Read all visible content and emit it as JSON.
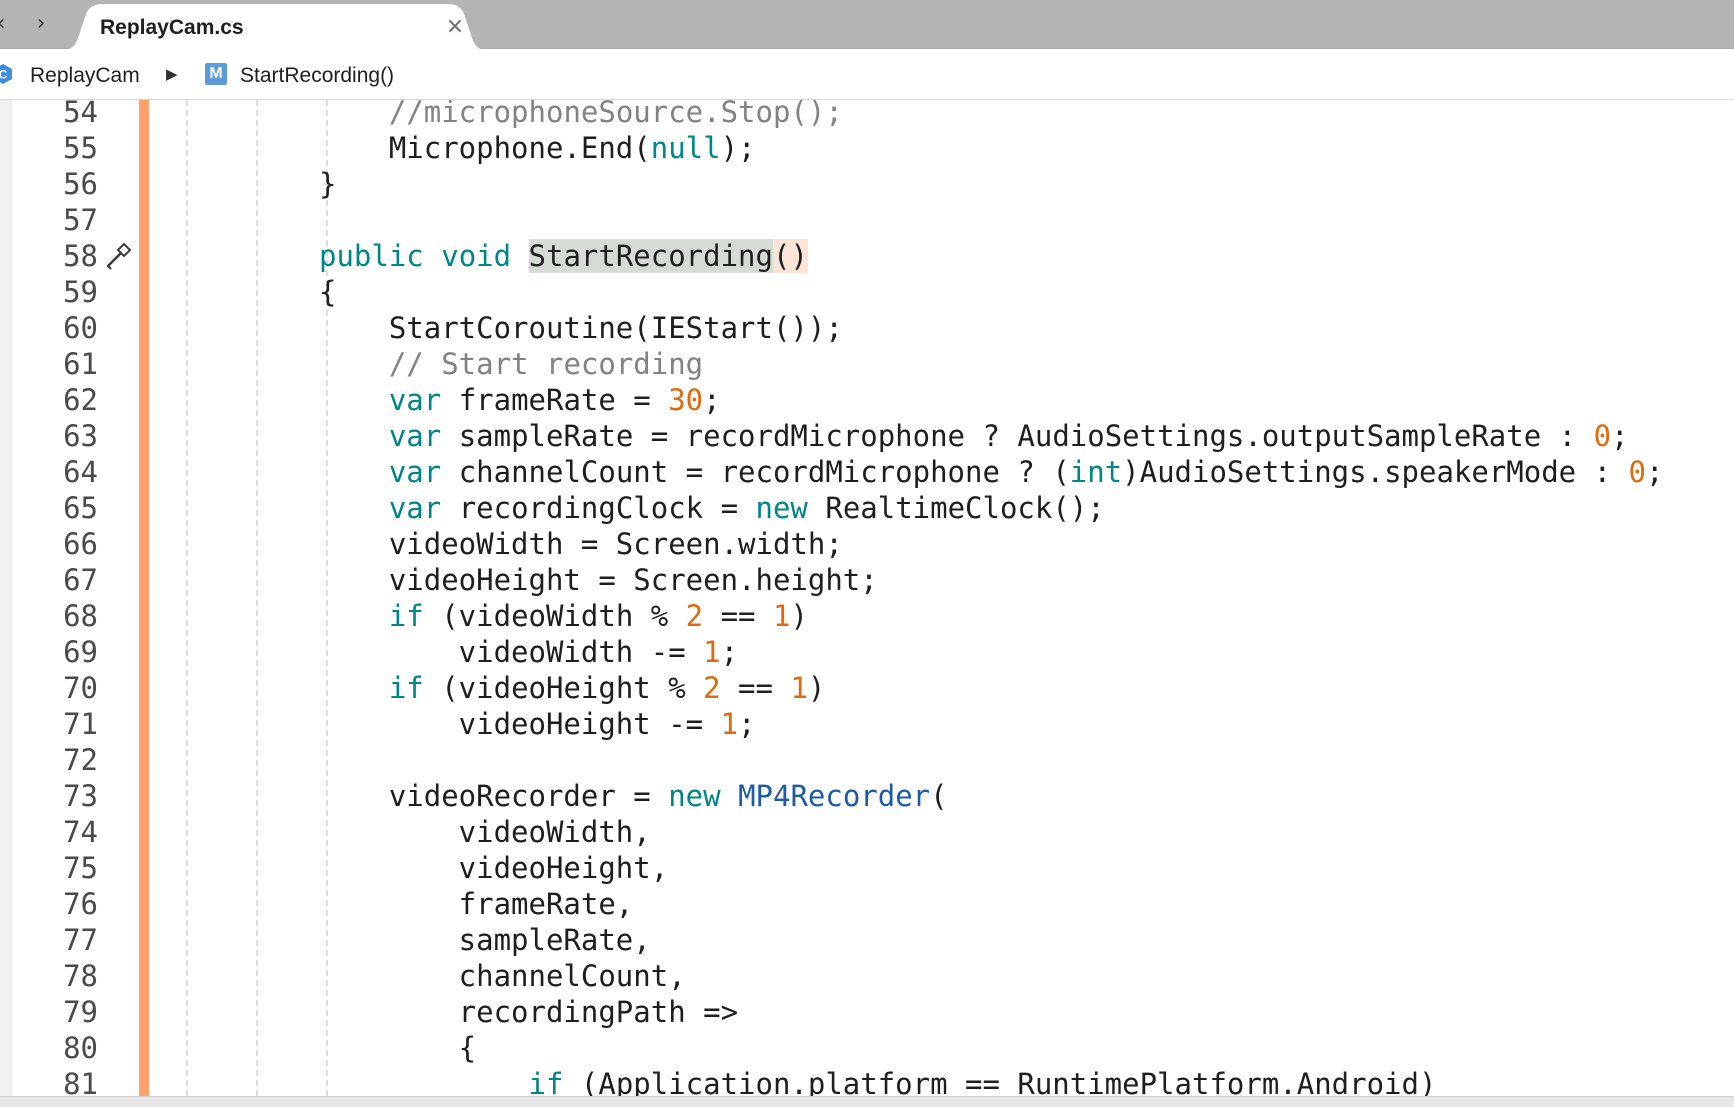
{
  "tabbar": {
    "back_glyph": "‹",
    "forward_glyph": "›",
    "tab_title": "ReplayCam.cs",
    "close_glyph": "×"
  },
  "breadcrumb": {
    "class_name": "ReplayCam",
    "class_icon": "class-icon",
    "separator": "▶",
    "method_icon_letter": "M",
    "method_name": "StartRecording()"
  },
  "colors": {
    "keyword": "#00858a",
    "number": "#de6a0d",
    "comment": "#828282",
    "type": "#1f5aa6",
    "change_bar": "#ff9f6b",
    "method_highlight": "#d4dcd4"
  },
  "editor": {
    "lines": [
      {
        "n": "54",
        "c": "    //microphoneSource.Stop();"
      },
      {
        "n": "55",
        "c": "    Microphone.End(null);"
      },
      {
        "n": "56",
        "c": "}"
      },
      {
        "n": "57",
        "c": ""
      },
      {
        "n": "58",
        "c": "public void StartRecording()",
        "gutter_icon": "hammer-icon"
      },
      {
        "n": "59",
        "c": "{"
      },
      {
        "n": "60",
        "c": "    StartCoroutine(IEStart());"
      },
      {
        "n": "61",
        "c": "    // Start recording"
      },
      {
        "n": "62",
        "c": "    var frameRate = 30;"
      },
      {
        "n": "63",
        "c": "    var sampleRate = recordMicrophone ? AudioSettings.outputSampleRate : 0;"
      },
      {
        "n": "64",
        "c": "    var channelCount = recordMicrophone ? (int)AudioSettings.speakerMode : 0;"
      },
      {
        "n": "65",
        "c": "    var recordingClock = new RealtimeClock();"
      },
      {
        "n": "66",
        "c": "    videoWidth = Screen.width;"
      },
      {
        "n": "67",
        "c": "    videoHeight = Screen.height;"
      },
      {
        "n": "68",
        "c": "    if (videoWidth % 2 == 1)"
      },
      {
        "n": "69",
        "c": "        videoWidth -= 1;"
      },
      {
        "n": "70",
        "c": "    if (videoHeight % 2 == 1)"
      },
      {
        "n": "71",
        "c": "        videoHeight -= 1;"
      },
      {
        "n": "72",
        "c": ""
      },
      {
        "n": "73",
        "c": "    videoRecorder = new MP4Recorder("
      },
      {
        "n": "74",
        "c": "        videoWidth,"
      },
      {
        "n": "75",
        "c": "        videoHeight,"
      },
      {
        "n": "76",
        "c": "        frameRate,"
      },
      {
        "n": "77",
        "c": "        sampleRate,"
      },
      {
        "n": "78",
        "c": "        channelCount,"
      },
      {
        "n": "79",
        "c": "        recordingPath =>"
      },
      {
        "n": "80",
        "c": "        {"
      },
      {
        "n": "81",
        "c": "            if (Application.platform == RuntimePlatform.Android)"
      }
    ]
  }
}
